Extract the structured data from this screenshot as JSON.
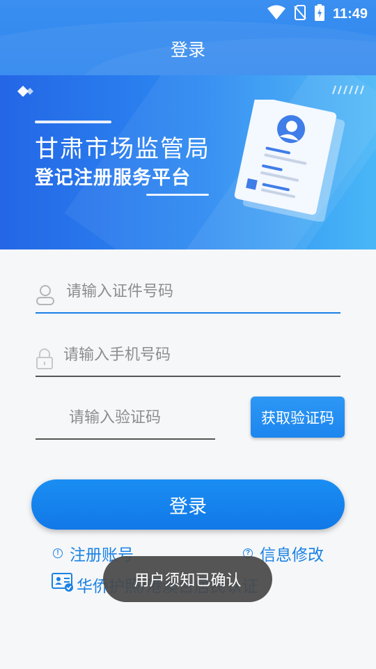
{
  "status_bar": {
    "time": "11:49",
    "icons": [
      "wifi-icon",
      "no-sim-icon",
      "battery-charging-icon"
    ]
  },
  "nav": {
    "title": "登录"
  },
  "banner": {
    "title_line1": "甘肃市场监管局",
    "title_line2": "登记注册服务平台"
  },
  "form": {
    "id_placeholder": "请输入证件号码",
    "phone_placeholder": "请输入手机号码",
    "code_placeholder": "请输入验证码",
    "get_code_label": "获取验证码",
    "login_label": "登录"
  },
  "links": {
    "register": "注册账号",
    "edit_info": "信息修改",
    "overseas": "华侨护照/港澳台居民认证"
  },
  "toast": {
    "message": "用户须知已确认"
  },
  "colors": {
    "primary": "#1a82e4",
    "header": "#3a8ff0",
    "toast_bg": "#484848"
  }
}
